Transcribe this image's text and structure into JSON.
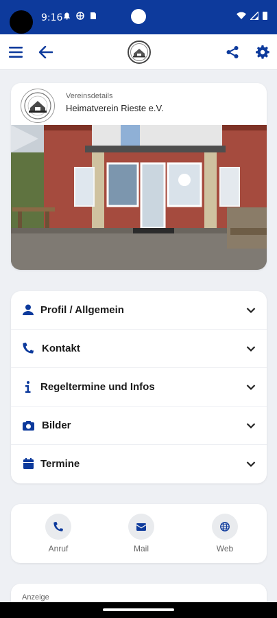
{
  "status_bar": {
    "time": "9:16",
    "left_icons": [
      "bell-icon",
      "target-icon",
      "sim-icon"
    ],
    "right_icons": [
      "wifi-icon",
      "signal-icon",
      "battery-icon"
    ]
  },
  "app_bar": {
    "menu_icon": "menu-icon",
    "back_icon": "arrow-left-icon",
    "share_icon": "share-icon",
    "settings_icon": "gear-icon",
    "logo": "club-logo"
  },
  "club": {
    "kicker": "Vereinsdetails",
    "name": "Heimatverein Rieste e.V.",
    "photo": "building-photo"
  },
  "accordion": [
    {
      "label": "Profil / Allgemein",
      "icon": "user-icon"
    },
    {
      "label": "Kontakt",
      "icon": "phone-icon"
    },
    {
      "label": "Regeltermine und Infos",
      "icon": "info-icon"
    },
    {
      "label": "Bilder",
      "icon": "camera-icon"
    },
    {
      "label": "Termine",
      "icon": "calendar-icon"
    }
  ],
  "contact": [
    {
      "label": "Anruf",
      "icon": "phone-icon"
    },
    {
      "label": "Mail",
      "icon": "mail-icon"
    },
    {
      "label": "Web",
      "icon": "globe-icon"
    }
  ],
  "ad": {
    "label": "Anzeige"
  },
  "colors": {
    "primary": "#0d3a9c",
    "background": "#eef0f4",
    "card": "#ffffff"
  }
}
